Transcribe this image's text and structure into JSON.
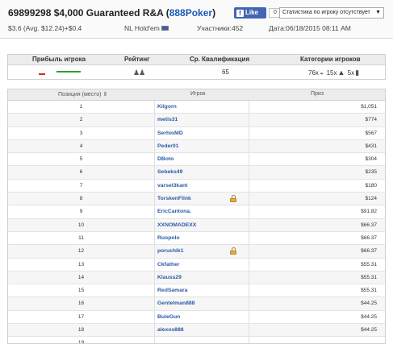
{
  "header": {
    "tournament_id": "69899298",
    "title": "$4,000 Guaranteed R&A",
    "network_open": "(",
    "network": "888Poker",
    "network_close": ")",
    "fb_like": "Like",
    "fb_count": "0",
    "stats_select": "Статистика по игроку отсутствует",
    "buyin": "$3.6 (Avg. $12.24)+$0.4",
    "game": "NL Hold'em",
    "participants": "Участники:452",
    "date": "Дата:06/18/2015 08:11 AM"
  },
  "summary": {
    "col_profit": "Прибыль игрока",
    "col_rating": "Рейтинг",
    "col_avg": "Ср. Квалификация",
    "col_categories": "Категории игроков",
    "avg_value": "65",
    "cat1_count": "76x",
    "cat2_count": "15x",
    "cat3_count": "5x"
  },
  "table": {
    "col_position": "Позиция (место) ⇕",
    "col_player": "Игрок",
    "col_prize": "Приз",
    "rows": [
      {
        "pos": "1",
        "player": "Kilgorn",
        "prize": "$1,051",
        "locked": false
      },
      {
        "pos": "2",
        "player": "metis31",
        "prize": "$774",
        "locked": false
      },
      {
        "pos": "3",
        "player": "SerhioMD",
        "prize": "$567",
        "locked": false
      },
      {
        "pos": "4",
        "player": "Peder01",
        "prize": "$431",
        "locked": false
      },
      {
        "pos": "5",
        "player": "DBoto",
        "prize": "$304",
        "locked": false
      },
      {
        "pos": "6",
        "player": "Sebeks49",
        "prize": "$235",
        "locked": false
      },
      {
        "pos": "7",
        "player": "varsel3kant",
        "prize": "$180",
        "locked": false
      },
      {
        "pos": "8",
        "player": "TorskenFlink",
        "prize": "$124",
        "locked": true
      },
      {
        "pos": "9",
        "player": "EricCantona.",
        "prize": "$91.82",
        "locked": false
      },
      {
        "pos": "10",
        "player": "XXNOMADEXX",
        "prize": "$66.37",
        "locked": false
      },
      {
        "pos": "11",
        "player": "Ruopolo",
        "prize": "$66.37",
        "locked": false
      },
      {
        "pos": "12",
        "player": "poruchik1",
        "prize": "$66.37",
        "locked": true
      },
      {
        "pos": "13",
        "player": "Ckfather",
        "prize": "$55.31",
        "locked": false
      },
      {
        "pos": "14",
        "player": "Klauss29",
        "prize": "$55.31",
        "locked": false
      },
      {
        "pos": "15",
        "player": "RedSamara",
        "prize": "$55.31",
        "locked": false
      },
      {
        "pos": "16",
        "player": "Gentelman888",
        "prize": "$44.25",
        "locked": false
      },
      {
        "pos": "17",
        "player": "BuleGun",
        "prize": "$44.25",
        "locked": false
      },
      {
        "pos": "18",
        "player": "alexos888",
        "prize": "$44.25",
        "locked": false
      },
      {
        "pos": "19",
        "player": "",
        "prize": "",
        "locked": false
      }
    ]
  },
  "colors": {
    "link": "#2a5aa8",
    "profit_negative": "#d03020",
    "profit_positive": "#2aa02a",
    "fb": "#4267b2"
  }
}
